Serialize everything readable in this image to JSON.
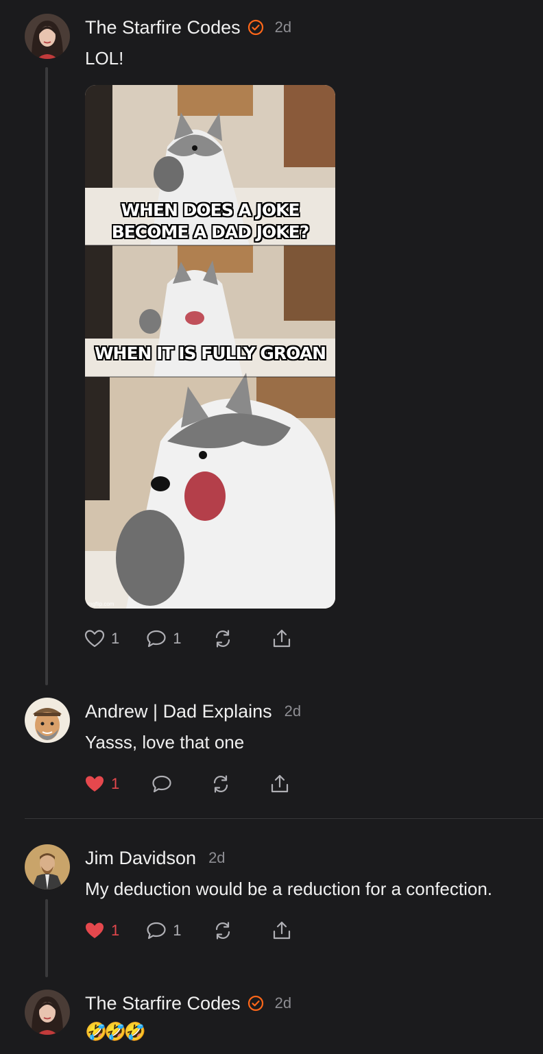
{
  "colors": {
    "background": "#1b1b1d",
    "accent": "#ff6719",
    "heart": "#e5484d",
    "muted": "#8e8e93"
  },
  "comments": [
    {
      "author": "The Starfire Codes",
      "verified": true,
      "time": "2d",
      "text": "LOL!",
      "image": {
        "caption_top_line1": "WHEN DOES A JOKE",
        "caption_top_line2": "BECOME A DAD JOKE?",
        "caption_bottom": "WHEN IT IS FULLY GROAN",
        "watermark": "imgflip.com"
      },
      "actions": {
        "likes": "1",
        "comments": "1",
        "liked": false
      }
    },
    {
      "author": "Andrew | Dad Explains",
      "verified": false,
      "time": "2d",
      "text": "Yasss, love that one",
      "actions": {
        "likes": "1",
        "comments": "",
        "liked": true
      }
    },
    {
      "author": "Jim Davidson",
      "verified": false,
      "time": "2d",
      "text": "My deduction would be a reduction for a confection.",
      "actions": {
        "likes": "1",
        "comments": "1",
        "liked": true
      }
    },
    {
      "author": "The Starfire Codes",
      "verified": true,
      "time": "2d",
      "text": "🤣🤣🤣"
    }
  ]
}
